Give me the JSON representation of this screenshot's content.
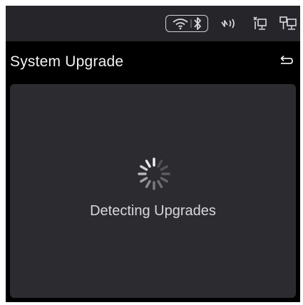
{
  "status_bar": {
    "icons": [
      "wifi-icon",
      "bluetooth-icon",
      "nfc-icon",
      "network-disconnected-icon",
      "network-icon"
    ]
  },
  "header": {
    "title": "System Upgrade",
    "back_icon": "back-icon"
  },
  "main": {
    "spinner_icon": "loading-spinner-icon",
    "status_text": "Detecting Upgrades"
  },
  "colors": {
    "status_bar_bg": "#26262a",
    "background": "#000000",
    "panel_bg": "#2c2c30",
    "text": "#f2f2f2"
  }
}
